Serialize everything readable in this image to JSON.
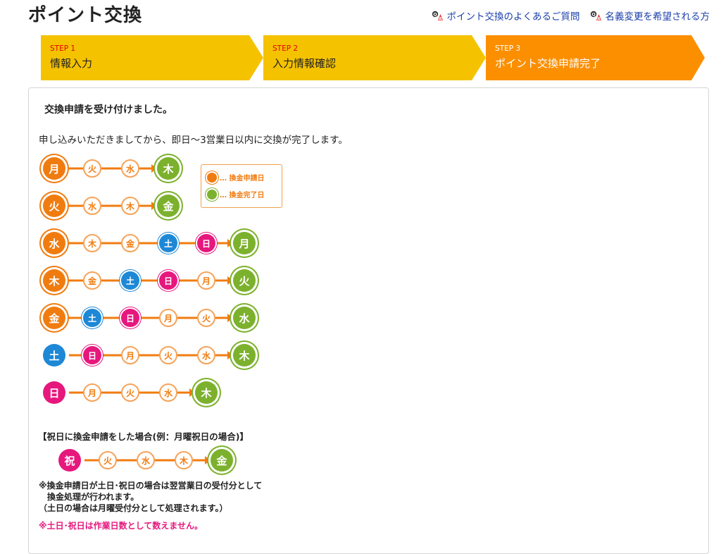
{
  "page": {
    "title": "ポイント交換"
  },
  "help_links": [
    {
      "label": "ポイント交換のよくあるご質問",
      "icon": "qa-icon"
    },
    {
      "label": "名義変更を希望される方",
      "icon": "qa-icon"
    }
  ],
  "steps": [
    {
      "num": "STEP 1",
      "label": "情報入力",
      "state": "done",
      "color": "#f5c200"
    },
    {
      "num": "STEP 2",
      "label": "入力情報確認",
      "state": "done",
      "color": "#f5c200"
    },
    {
      "num": "STEP 3",
      "label": "ポイント交換申請完了",
      "state": "current",
      "color": "#fc8f00"
    }
  ],
  "content": {
    "heading": "交換申請を受け付けました。",
    "text": "申し込みいただきましてから、即日〜3営業日以内に交換が完了します。"
  },
  "legend": {
    "apply_label": "… 換金申請日",
    "complete_label": "… 換金完了日"
  },
  "schedule": [
    {
      "days": [
        {
          "d": "月",
          "t": "apply"
        },
        {
          "d": "火",
          "t": "work"
        },
        {
          "d": "水",
          "t": "work"
        },
        {
          "d": "木",
          "t": "done"
        }
      ]
    },
    {
      "days": [
        {
          "d": "火",
          "t": "apply"
        },
        {
          "d": "水",
          "t": "work"
        },
        {
          "d": "木",
          "t": "work"
        },
        {
          "d": "金",
          "t": "done"
        }
      ]
    },
    {
      "days": [
        {
          "d": "水",
          "t": "apply"
        },
        {
          "d": "木",
          "t": "work"
        },
        {
          "d": "金",
          "t": "work"
        },
        {
          "d": "土",
          "t": "sat"
        },
        {
          "d": "日",
          "t": "sun"
        },
        {
          "d": "月",
          "t": "done"
        }
      ]
    },
    {
      "days": [
        {
          "d": "木",
          "t": "apply"
        },
        {
          "d": "金",
          "t": "work"
        },
        {
          "d": "土",
          "t": "sat"
        },
        {
          "d": "日",
          "t": "sun"
        },
        {
          "d": "月",
          "t": "work"
        },
        {
          "d": "火",
          "t": "done"
        }
      ]
    },
    {
      "days": [
        {
          "d": "金",
          "t": "apply"
        },
        {
          "d": "土",
          "t": "sat"
        },
        {
          "d": "日",
          "t": "sun"
        },
        {
          "d": "月",
          "t": "work"
        },
        {
          "d": "火",
          "t": "work"
        },
        {
          "d": "水",
          "t": "done"
        }
      ]
    },
    {
      "days": [
        {
          "d": "土",
          "t": "sat_apply"
        },
        {
          "d": "日",
          "t": "sun"
        },
        {
          "d": "月",
          "t": "work"
        },
        {
          "d": "火",
          "t": "work"
        },
        {
          "d": "水",
          "t": "work"
        },
        {
          "d": "木",
          "t": "done"
        }
      ]
    },
    {
      "days": [
        {
          "d": "日",
          "t": "sun_apply"
        },
        {
          "d": "月",
          "t": "work"
        },
        {
          "d": "火",
          "t": "work"
        },
        {
          "d": "水",
          "t": "work"
        },
        {
          "d": "木",
          "t": "done"
        }
      ]
    }
  ],
  "holiday": {
    "title": "【祝日に換金申請をした場合(例：月曜祝日の場合)】",
    "days": [
      {
        "d": "祝",
        "t": "sun_apply"
      },
      {
        "d": "火",
        "t": "work"
      },
      {
        "d": "水",
        "t": "work"
      },
      {
        "d": "木",
        "t": "work"
      },
      {
        "d": "金",
        "t": "done"
      }
    ],
    "note_line1": "※換金申請日が土日･祝日の場合は翌営業日の受付分として",
    "note_line2": "換金処理が行われます。",
    "note_line3": "（土日の場合は月曜受付分として処理されます。）",
    "note_red": "※土日･祝日は作業日数として数えません。"
  },
  "colors": {
    "orange": "#f07c10",
    "green": "#7cb12d",
    "blue": "#1e88d6",
    "pink": "#e6177d",
    "link": "#1a3faa"
  }
}
